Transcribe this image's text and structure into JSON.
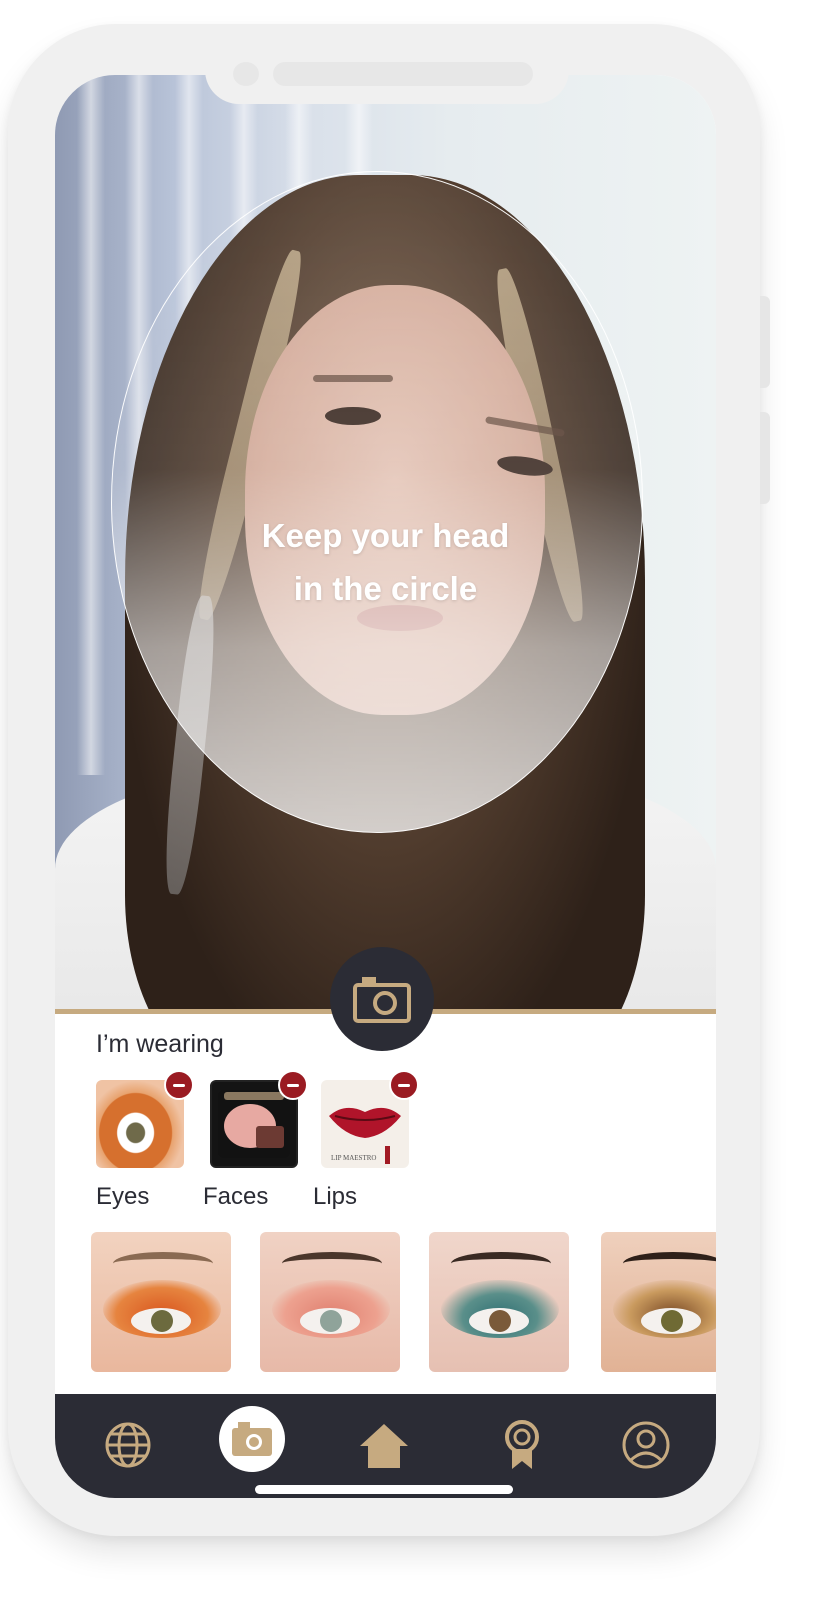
{
  "camera": {
    "guide_text_line1": "Keep your head",
    "guide_text_line2": "in the circle"
  },
  "wearing": {
    "title": "I’m wearing",
    "items": [
      {
        "label": "Eyes"
      },
      {
        "label": "Faces"
      },
      {
        "label": "Lips"
      }
    ],
    "lips_product_text": "LIP MAESTRO"
  },
  "looks": [
    {
      "name": "orange-eye-look"
    },
    {
      "name": "pink-eye-look"
    },
    {
      "name": "teal-eye-look"
    },
    {
      "name": "bronze-eye-look"
    }
  ],
  "nav": {
    "items": [
      {
        "icon": "globe-icon"
      },
      {
        "icon": "camera-icon",
        "active": true
      },
      {
        "icon": "home-icon"
      },
      {
        "icon": "award-icon"
      },
      {
        "icon": "profile-icon"
      }
    ]
  },
  "colors": {
    "accent_gold": "#c6aa80",
    "dark": "#2b2c35",
    "remove_red": "#9a1b22"
  }
}
